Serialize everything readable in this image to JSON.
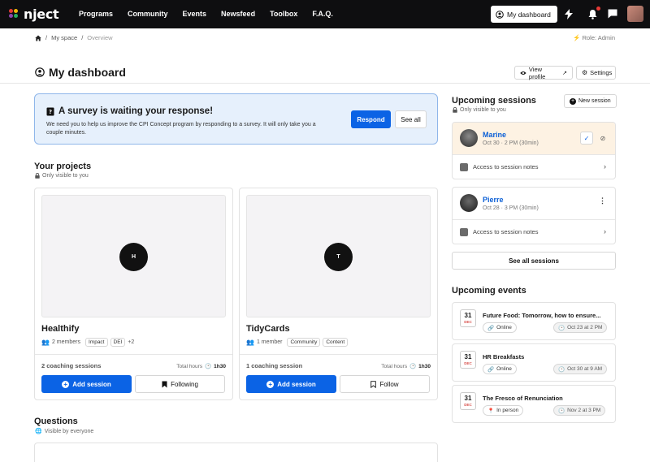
{
  "brand": {
    "name": "nject",
    "colors": [
      "#e53935",
      "#8e44ad",
      "#f2b705",
      "#27ae60"
    ]
  },
  "nav": {
    "links": [
      "Programs",
      "Community",
      "Events",
      "Newsfeed",
      "Toolbox",
      "F.A.Q."
    ],
    "dashboard_label": "My dashboard",
    "icons": [
      "bolt-icon",
      "bell-icon",
      "chat-icon"
    ]
  },
  "breadcrumb": {
    "items": [
      "My space",
      "Overview"
    ],
    "separator": "/"
  },
  "role": "Role: Admin",
  "page": {
    "title": "My dashboard",
    "view_profile": "View profile",
    "settings": "Settings"
  },
  "survey": {
    "title": "A survey is waiting your response!",
    "text": "We need you to help us improve the CPI Concept program by responding to a survey. It will only take you a couple minutes.",
    "respond": "Respond",
    "see_all": "See all"
  },
  "projects": {
    "title": "Your projects",
    "subtitle": "Only visible to you",
    "items": [
      {
        "initial": "H",
        "name": "Healthify",
        "members": "2 members",
        "tags": [
          "Impact",
          "DEI"
        ],
        "more": "+2",
        "sessions": "2 coaching sessions",
        "hours_label": "Total hours",
        "hours": "1h30",
        "add": "Add session",
        "follow": "Following"
      },
      {
        "initial": "T",
        "name": "TidyCards",
        "members": "1 member",
        "tags": [
          "Community",
          "Content"
        ],
        "more": "",
        "sessions": "1 coaching session",
        "hours_label": "Total hours",
        "hours": "1h30",
        "add": "Add session",
        "follow": "Follow"
      }
    ]
  },
  "questions": {
    "title": "Questions",
    "subtitle": "Visible by everyone"
  },
  "sessions": {
    "title": "Upcoming sessions",
    "subtitle": "Only visible to you",
    "new_session": "New session",
    "notes_label": "Access to session notes",
    "see_all": "See all sessions",
    "items": [
      {
        "name": "Marine",
        "date": "Oct 30 · 2 PM (30min)",
        "highlight": "#fdf2e3"
      },
      {
        "name": "Pierre",
        "date": "Oct 28 · 3 PM (30min)",
        "highlight": "#ffffff"
      }
    ]
  },
  "events": {
    "title": "Upcoming events",
    "items": [
      {
        "day": "31",
        "month": "DEC",
        "title": "Future Food: Tomorrow, how to ensure...",
        "mode": "Online",
        "date": "Oct 23 at 2 PM"
      },
      {
        "day": "31",
        "month": "DEC",
        "title": "HR Breakfasts",
        "mode": "Online",
        "date": "Oct 30 at 9 AM"
      },
      {
        "day": "31",
        "month": "DEC",
        "title": "The Fresco of Renunciation",
        "mode": "In person",
        "date": "Nov 2 at 3 PM"
      }
    ]
  }
}
